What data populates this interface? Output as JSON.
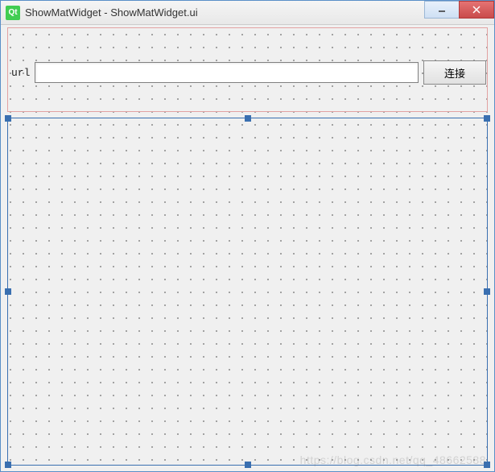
{
  "window": {
    "icon_text": "Qt",
    "title": "ShowMatWidget - ShowMatWidget.ui"
  },
  "form": {
    "url_label": "url",
    "url_value": "",
    "connect_label": "连接"
  },
  "watermark": "https://blog.csdn.net/qq_48662588"
}
